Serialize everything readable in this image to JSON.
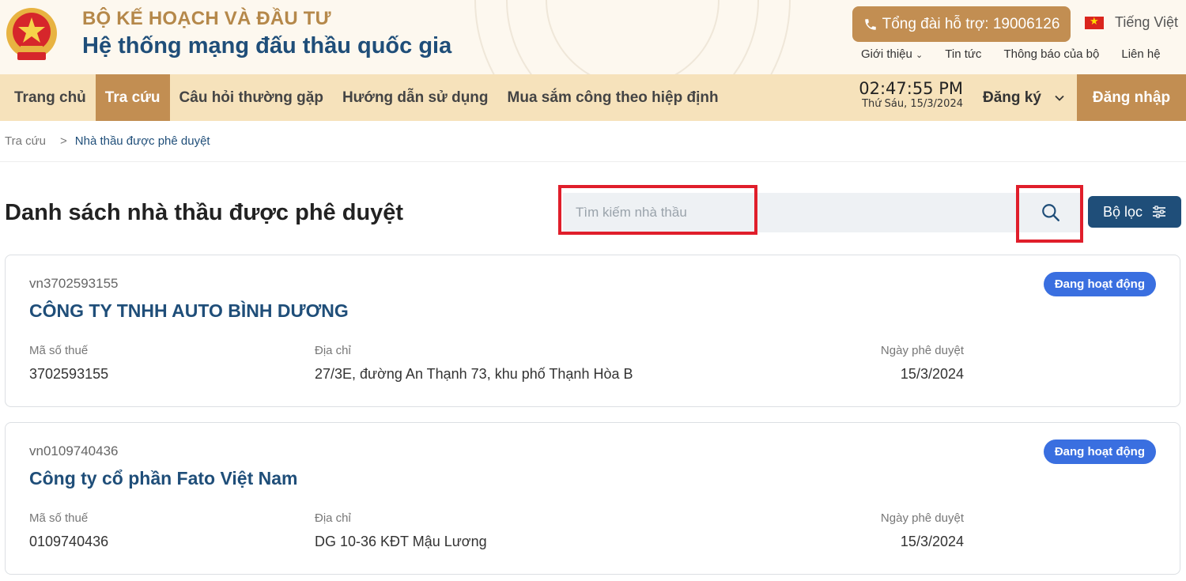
{
  "header": {
    "ministry": "BỘ KẾ HOẠCH VÀ ĐẦU TƯ",
    "system_name": "Hệ thống mạng đấu thầu quốc gia",
    "hotline": "Tổng đài hỗ trợ: 19006126",
    "language": "Tiếng Việt",
    "top_links": [
      "Giới thiệu",
      "Tin tức",
      "Thông báo của bộ",
      "Liên hệ"
    ]
  },
  "nav": {
    "items": [
      "Trang chủ",
      "Tra cứu",
      "Câu hỏi thường gặp",
      "Hướng dẫn sử dụng",
      "Mua sắm công theo hiệp định"
    ],
    "active": "Tra cứu",
    "time": "02:47:55 PM",
    "date": "Thứ Sáu, 15/3/2024",
    "register": "Đăng ký",
    "login": "Đăng nhập"
  },
  "breadcrumb": [
    "Tra cứu",
    ">",
    "Nhà thầu được phê duyệt"
  ],
  "page": {
    "title": "Danh sách nhà thầu được phê duyệt",
    "search_placeholder": "Tìm kiếm nhà thầu",
    "filter_label": "Bộ lọc"
  },
  "contractors": [
    {
      "code": "vn3702593155",
      "name": "CÔNG TY TNHH AUTO BÌNH DƯƠNG",
      "status": "Đang hoạt động",
      "tax_label": "Mã số thuế",
      "tax": "3702593155",
      "address_label": "Địa chỉ",
      "address": "27/3E, đường An Thạnh 73, khu phố Thạnh Hòa B",
      "date_label": "Ngày phê duyệt",
      "date": "15/3/2024"
    },
    {
      "code": "vn0109740436",
      "name": "Công ty cổ phần Fato Việt Nam",
      "status": "Đang hoạt động",
      "tax_label": "Mã số thuế",
      "tax": "0109740436",
      "address_label": "Địa chỉ",
      "address": "DG 10-36 KĐT Mậu Lương",
      "date_label": "Ngày phê duyệt",
      "date": "15/3/2024"
    }
  ],
  "colors": {
    "brand_gold": "#c28e52",
    "nav_bg": "#f6e2bb",
    "primary_blue": "#1f4e79",
    "status_blue": "#3a6fe0",
    "highlight_red": "#e01e2b"
  }
}
